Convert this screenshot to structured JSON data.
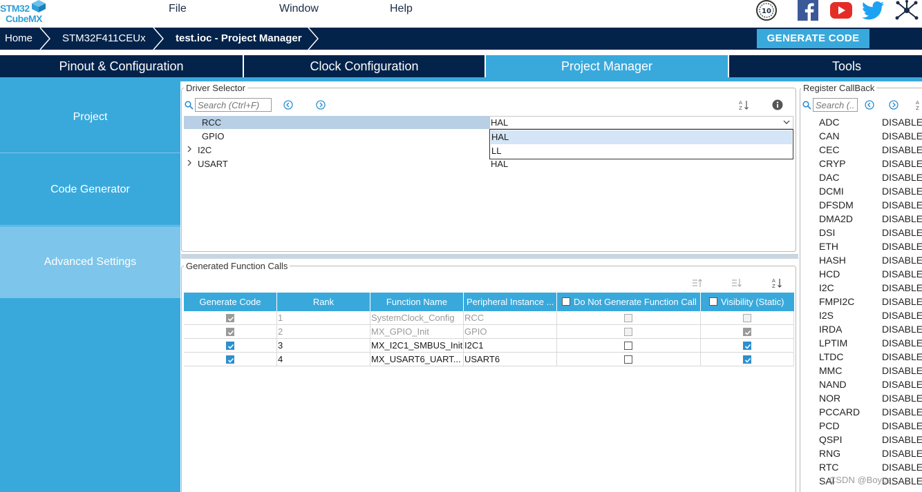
{
  "app": {
    "logo_line1": "STM32",
    "logo_line2": "CubeMX"
  },
  "menu": [
    "File",
    "Window",
    "Help"
  ],
  "social": [
    "anniversary-badge-icon",
    "facebook-icon",
    "youtube-icon",
    "twitter-icon",
    "network-icon"
  ],
  "breadcrumb": [
    "Home",
    "STM32F411CEUx",
    "test.ioc - Project Manager"
  ],
  "generate_button": "GENERATE CODE",
  "tabs": [
    "Pinout & Configuration",
    "Clock Configuration",
    "Project Manager",
    "Tools"
  ],
  "active_tab": "Project Manager",
  "sidebar": [
    "Project",
    "Code Generator",
    "Advanced Settings"
  ],
  "driver_selector": {
    "title": "Driver Selector",
    "search_placeholder": "Search (Ctrl+F)",
    "rows": [
      {
        "name": "RCC",
        "driver": "HAL",
        "selected": true
      },
      {
        "name": "GPIO",
        "driver": ""
      },
      {
        "name": "I2C",
        "driver": "",
        "expandable": true
      },
      {
        "name": "USART",
        "driver": "HAL",
        "expandable": true
      }
    ],
    "dropdown_value": "HAL",
    "dropdown_options": [
      "HAL",
      "LL"
    ]
  },
  "function_calls": {
    "title": "Generated Function Calls",
    "headers": [
      "Generate Code",
      "Rank",
      "Function Name",
      "Peripheral Instance ...",
      "Do Not Generate Function Call",
      "Visibility (Static)"
    ],
    "rows": [
      {
        "rank": "1",
        "function": "SystemClock_Config",
        "instance": "RCC",
        "generate": true,
        "no_generate": false,
        "visibility": false,
        "disabled": true
      },
      {
        "rank": "2",
        "function": "MX_GPIO_Init",
        "instance": "GPIO",
        "generate": true,
        "no_generate": false,
        "visibility": true,
        "disabled": true
      },
      {
        "rank": "3",
        "function": "MX_I2C1_SMBUS_Init",
        "instance": "I2C1",
        "generate": true,
        "no_generate": false,
        "visibility": true,
        "disabled": false
      },
      {
        "rank": "4",
        "function": "MX_USART6_UART...",
        "instance": "USART6",
        "generate": true,
        "no_generate": false,
        "visibility": true,
        "disabled": false
      }
    ]
  },
  "register_callback": {
    "title": "Register CallBack",
    "search_placeholder": "Search (...",
    "rows": [
      [
        "ADC",
        "DISABLE"
      ],
      [
        "CAN",
        "DISABLE"
      ],
      [
        "CEC",
        "DISABLE"
      ],
      [
        "CRYP",
        "DISABLE"
      ],
      [
        "DAC",
        "DISABLE"
      ],
      [
        "DCMI",
        "DISABLE"
      ],
      [
        "DFSDM",
        "DISABLE"
      ],
      [
        "DMA2D",
        "DISABLE"
      ],
      [
        "DSI",
        "DISABLE"
      ],
      [
        "ETH",
        "DISABLE"
      ],
      [
        "HASH",
        "DISABLE"
      ],
      [
        "HCD",
        "DISABLE"
      ],
      [
        "I2C",
        "DISABLE"
      ],
      [
        "FMPI2C",
        "DISABLE"
      ],
      [
        "I2S",
        "DISABLE"
      ],
      [
        "IRDA",
        "DISABLE"
      ],
      [
        "LPTIM",
        "DISABLE"
      ],
      [
        "LTDC",
        "DISABLE"
      ],
      [
        "MMC",
        "DISABLE"
      ],
      [
        "NAND",
        "DISABLE"
      ],
      [
        "NOR",
        "DISABLE"
      ],
      [
        "PCCARD",
        "DISABLE"
      ],
      [
        "PCD",
        "DISABLE"
      ],
      [
        "QSPI",
        "DISABLE"
      ],
      [
        "RNG",
        "DISABLE"
      ],
      [
        "RTC",
        "DISABLE"
      ],
      [
        "SAI",
        "DISABLE"
      ]
    ]
  },
  "watermark": "CSDN @Boyce_",
  "colors": {
    "navy": "#03234b",
    "accent": "#39a9dc",
    "sidebar_active": "#7dc5ea"
  }
}
